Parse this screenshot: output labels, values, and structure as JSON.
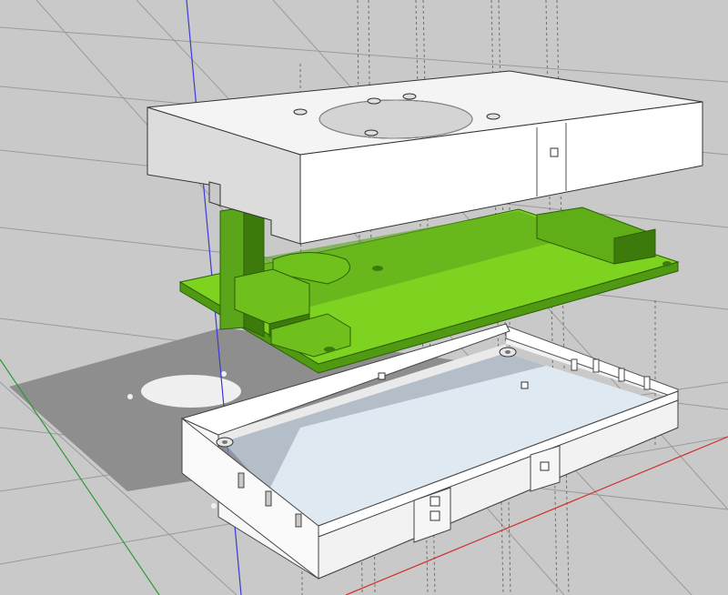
{
  "viewport": {
    "background": "#c9c9c9",
    "guide_color": "#8a8a8a"
  },
  "colors": {
    "lid_top": "#f4f4f4",
    "lid_side": "#dcdcdc",
    "lid_front": "#ffffff",
    "pcb_top": "#7ed321",
    "pcb_side": "#4f9a12",
    "pcb_dark": "#3d7a0c",
    "base_wall": "#f7f7f7",
    "base_inner": "#dfe9f2",
    "shadow": "#8e8e8e",
    "axis_blue": "#3a3ad6",
    "axis_red": "#d03030",
    "axis_green": "#2f9a2f"
  },
  "scene": {
    "objects": [
      "lid",
      "pcb",
      "base"
    ],
    "axes": [
      "blue-axis",
      "red-axis",
      "green-axis"
    ]
  }
}
